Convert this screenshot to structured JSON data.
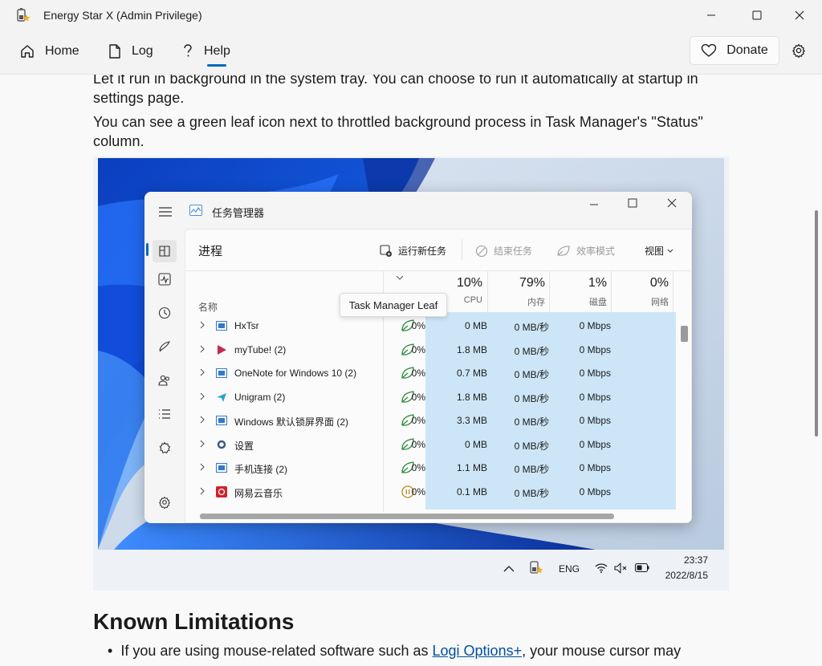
{
  "window": {
    "title": "Energy Star X  (Admin Privilege)"
  },
  "nav": {
    "home": "Home",
    "log": "Log",
    "help": "Help",
    "donate": "Donate"
  },
  "content": {
    "para1": "Let it run in background in the system tray. You can choose to run it automatically at startup in settings page.",
    "para2": "You can see a green leaf icon next to throttled background process in Task Manager's \"Status\" column.",
    "heading": "Known Limitations",
    "bullet_pre": "If you are using mouse-related software such as ",
    "bullet_link": "Logi Options+",
    "bullet_post": ", your mouse cursor may"
  },
  "task_manager": {
    "title": "任务管理器",
    "section": "进程",
    "actions": {
      "run_new_task": "运行新任务",
      "end_task": "结束任务",
      "efficiency_mode": "效率模式",
      "view": "视图"
    },
    "columns": {
      "name": "名称",
      "cpu_pct": "10%",
      "cpu": "CPU",
      "mem_pct": "79%",
      "mem": "内存",
      "disk_pct": "1%",
      "disk": "磁盘",
      "net_pct": "0%",
      "net": "网络"
    },
    "tooltip": "Task Manager Leaf",
    "rows": [
      {
        "name": "HxTsr",
        "cpu": "0%",
        "mem": "0 MB",
        "disk": "0 MB/秒",
        "net": "0 Mbps",
        "status": "leaf"
      },
      {
        "name": "myTube! (2)",
        "cpu": "0%",
        "mem": "1.8 MB",
        "disk": "0 MB/秒",
        "net": "0 Mbps",
        "status": "leaf"
      },
      {
        "name": "OneNote for Windows 10 (2)",
        "cpu": "0%",
        "mem": "0.7 MB",
        "disk": "0 MB/秒",
        "net": "0 Mbps",
        "status": "leaf"
      },
      {
        "name": "Unigram (2)",
        "cpu": "0%",
        "mem": "1.8 MB",
        "disk": "0 MB/秒",
        "net": "0 Mbps",
        "status": "leaf"
      },
      {
        "name": "Windows 默认锁屏界面 (2)",
        "cpu": "0%",
        "mem": "3.3 MB",
        "disk": "0 MB/秒",
        "net": "0 Mbps",
        "status": "leaf"
      },
      {
        "name": "设置",
        "cpu": "0%",
        "mem": "0 MB",
        "disk": "0 MB/秒",
        "net": "0 Mbps",
        "status": "leaf"
      },
      {
        "name": "手机连接 (2)",
        "cpu": "0%",
        "mem": "1.1 MB",
        "disk": "0 MB/秒",
        "net": "0 Mbps",
        "status": "leaf"
      },
      {
        "name": "网易云音乐",
        "cpu": "0%",
        "mem": "0.1 MB",
        "disk": "0 MB/秒",
        "net": "0 Mbps",
        "status": "paused"
      }
    ]
  },
  "taskbar": {
    "lang": "ENG",
    "time": "23:37",
    "date": "2022/8/15"
  },
  "colors": {
    "accent": "#0067c0",
    "leaf": "#2e8b3e",
    "highlight": "#cde6f7"
  }
}
